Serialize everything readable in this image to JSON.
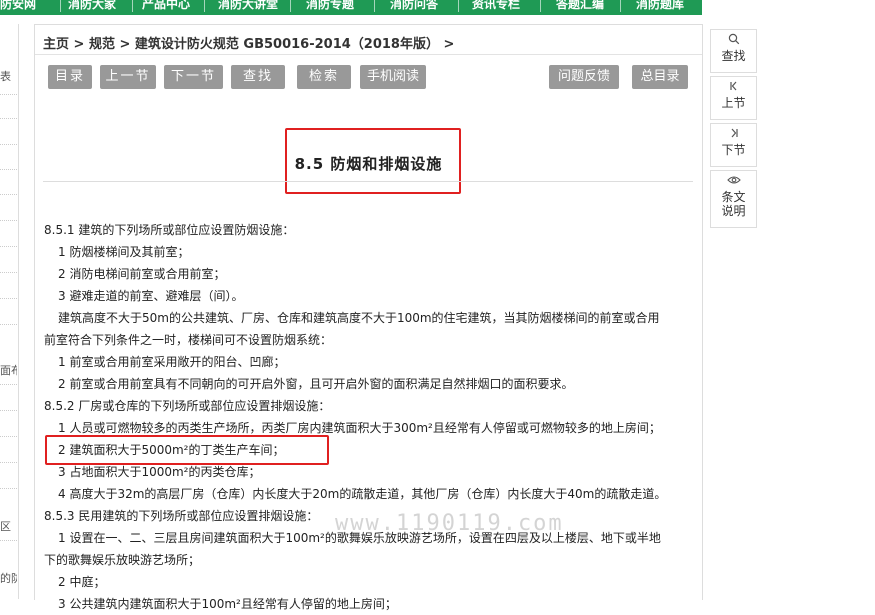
{
  "topnav": {
    "items": [
      "防安网",
      "消防大家",
      "产品中心",
      "消防大讲堂",
      "消防专题",
      "消防问答",
      "资讯专栏",
      "答题汇编",
      "消防题库"
    ]
  },
  "left_panel": {
    "snippets": [
      "表",
      "面布",
      "区",
      "的防"
    ]
  },
  "breadcrumb": "主页 > 规范 > 建筑设计防火规范 GB50016-2014（2018年版） >",
  "toolbar": {
    "toc": "目录",
    "prev": "上一节",
    "next": "下一节",
    "find": "查找",
    "search": "检索",
    "mobile": "手机阅读",
    "feedback": "问题反馈",
    "master_toc": "总目录"
  },
  "section_title": "8.5 防烟和排烟设施",
  "content": [
    "8.5.1 建筑的下列场所或部位应设置防烟设施：",
    "1 防烟楼梯间及其前室；",
    "2 消防电梯间前室或合用前室；",
    "3 避难走道的前室、避难层（间）。",
    "建筑高度不大于50m的公共建筑、厂房、仓库和建筑高度不大于100m的住宅建筑，当其防烟楼梯间的前室或合用",
    "前室符合下列条件之一时，楼梯间可不设置防烟系统：",
    "1 前室或合用前室采用敞开的阳台、凹廊；",
    "2 前室或合用前室具有不同朝向的可开启外窗，且可开启外窗的面积满足自然排烟口的面积要求。",
    "8.5.2 厂房或仓库的下列场所或部位应设置排烟设施：",
    "1 人员或可燃物较多的丙类生产场所，丙类厂房内建筑面积大于300m²且经常有人停留或可燃物较多的地上房间；",
    "2 建筑面积大于5000m²的丁类生产车间；",
    "3 占地面积大于1000m²的丙类仓库；",
    "4 高度大于32m的高层厂房（仓库）内长度大于20m的疏散走道，其他厂房（仓库）内长度大于40m的疏散走道。",
    "8.5.3 民用建筑的下列场所或部位应设置排烟设施：",
    "1 设置在一、二、三层且房间建筑面积大于100m²的歌舞娱乐放映游艺场所，设置在四层及以上楼层、地下或半地",
    "下的歌舞娱乐放映游艺场所；",
    "2 中庭；",
    "3 公共建筑内建筑面积大于100m²且经常有人停留的地上房间；"
  ],
  "watermark": "www.1190119.com",
  "side_tools": {
    "find": "查找",
    "prev": "上节",
    "next": "下节",
    "explain_1": "条文",
    "explain_2": "说明"
  },
  "colors": {
    "nav_green": "#1f9a55",
    "highlight_red": "#e02020",
    "button_gray": "#999999"
  }
}
